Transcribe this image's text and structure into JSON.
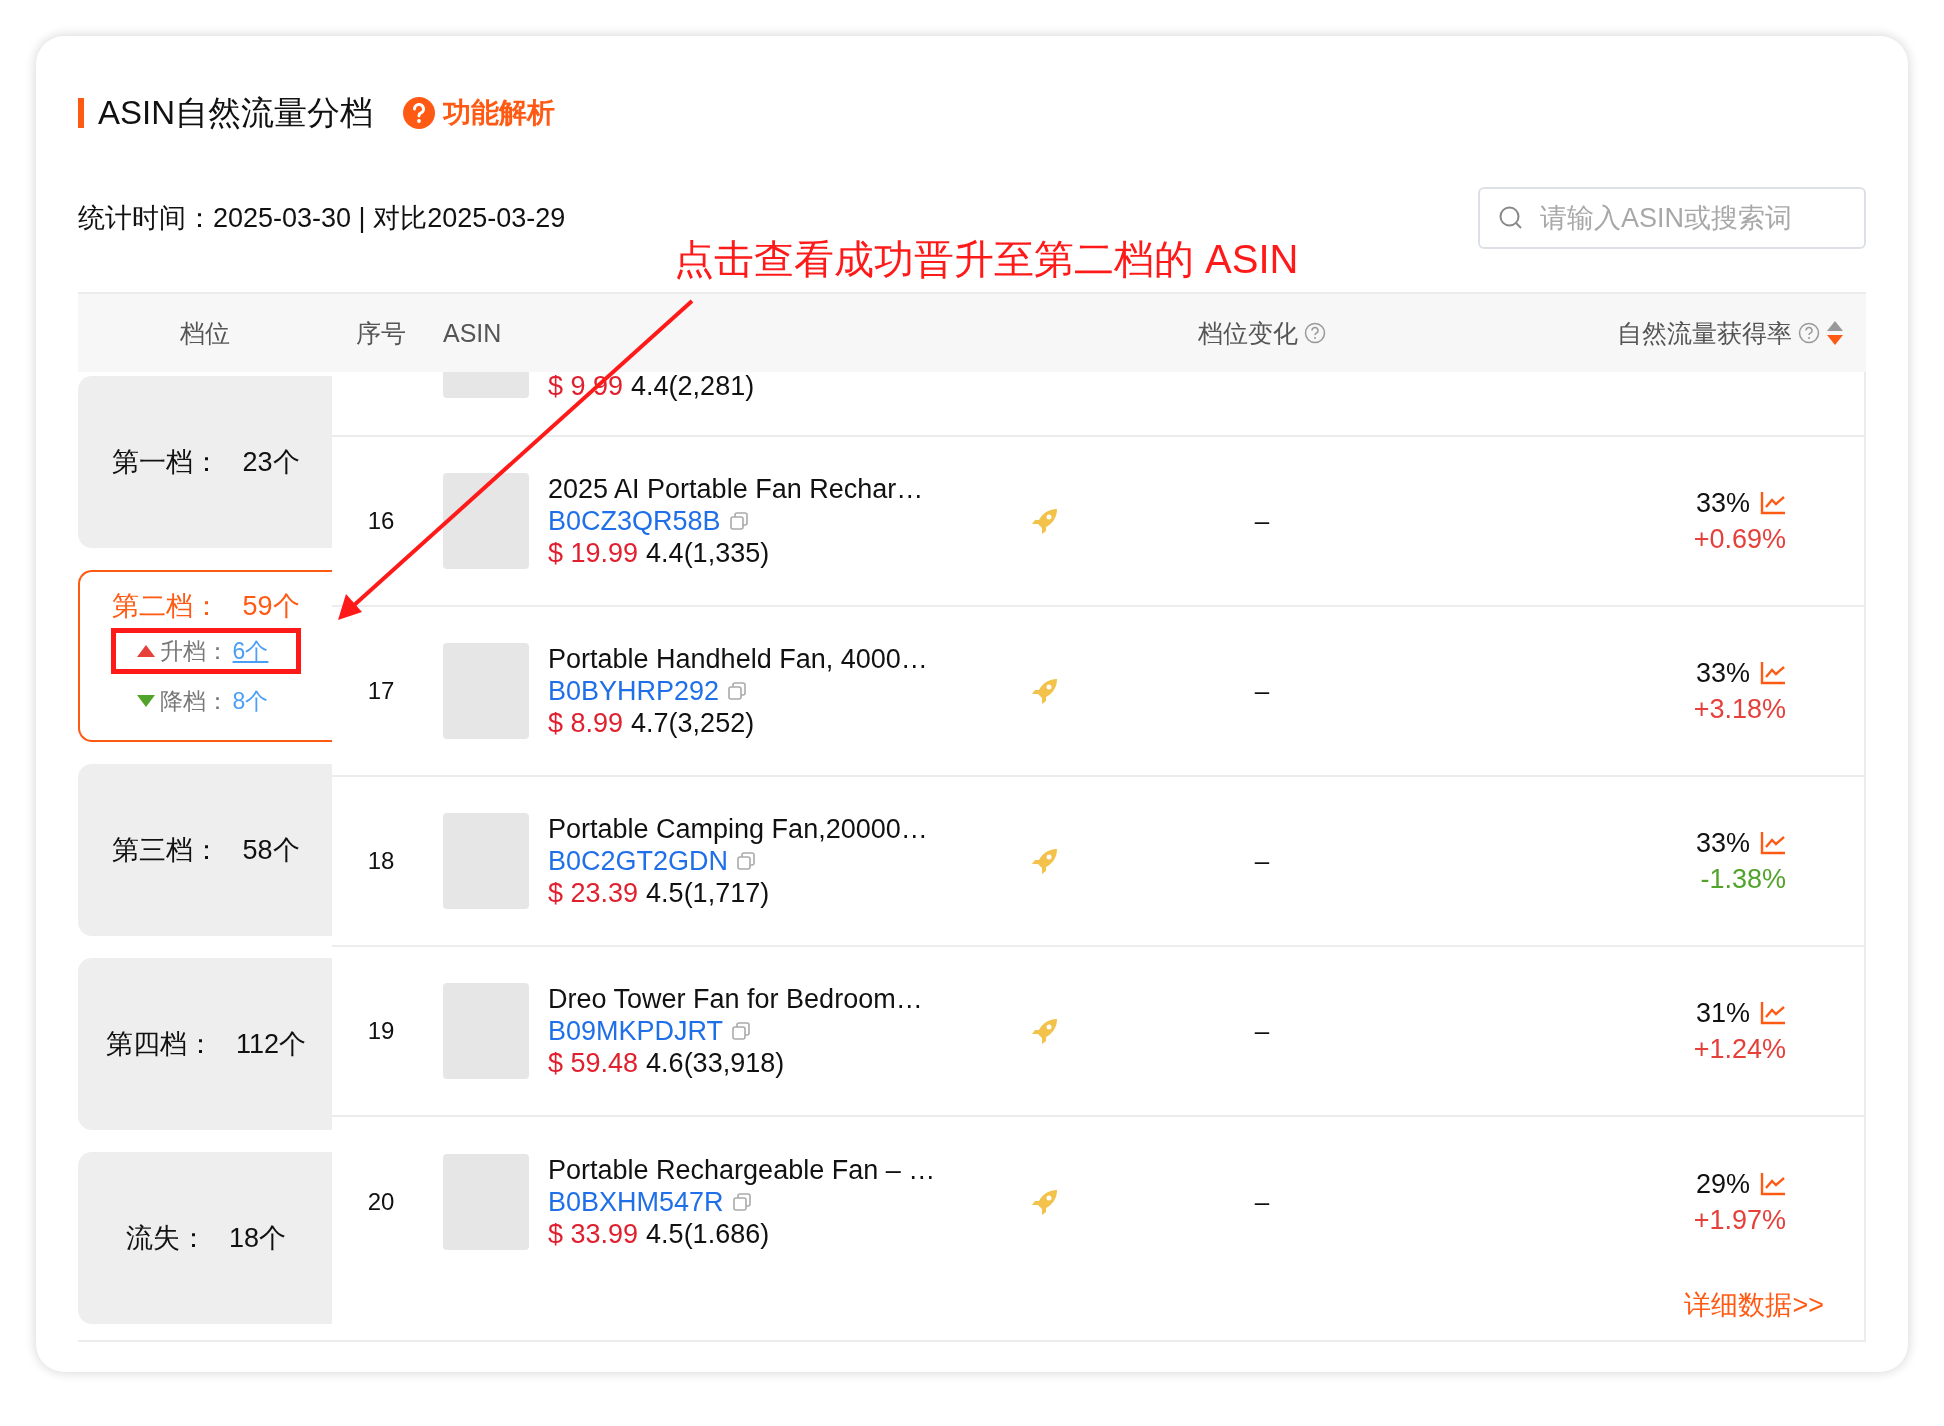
{
  "header": {
    "title": "ASIN自然流量分档",
    "help_link": "功能解析"
  },
  "stats": {
    "text": "统计时间：2025-03-30 | 对比2025-03-29"
  },
  "search": {
    "placeholder": "请输入ASIN或搜索词"
  },
  "annotation": {
    "text": "点击查看成功晋升至第二档的 ASIN"
  },
  "table": {
    "columns": [
      {
        "label": "档位"
      },
      {
        "label": "序号"
      },
      {
        "label": "ASIN"
      },
      {
        "label": "档位变化",
        "help": true
      },
      {
        "label": "自然流量获得率",
        "help": true,
        "sort_desc": true
      }
    ],
    "tiers": [
      {
        "label": "第一档：",
        "count": "23个",
        "selected": false
      },
      {
        "label": "第二档：",
        "count": "59个",
        "selected": true,
        "changes": [
          {
            "kind": "up",
            "label": "升档：",
            "count": "6个",
            "hovered": true,
            "annotated": true
          },
          {
            "kind": "down",
            "label": "降档：",
            "count": "8个",
            "hovered": false,
            "annotated": false
          }
        ]
      },
      {
        "label": "第三档：",
        "count": "58个",
        "selected": false
      },
      {
        "label": "第四档：",
        "count": "112个",
        "selected": false
      },
      {
        "label": "流失：",
        "count": "18个",
        "selected": false
      }
    ],
    "rows": [
      {
        "kind": "partial",
        "price": "$ 9.99",
        "rating": "4.4(2,281)"
      },
      {
        "kind": "full",
        "index": "16",
        "name": "2025 AI Portable Fan Rechar…",
        "asin": "B0CZ3QR58B",
        "price": "$ 19.99",
        "rating": "4.4(1,335)",
        "boosted": true,
        "tier_change": "–",
        "rate": "33%",
        "delta": "+0.69%",
        "rising": true
      },
      {
        "kind": "full",
        "index": "17",
        "name": "Portable Handheld Fan, 4000…",
        "asin": "B0BYHRP292",
        "price": "$ 8.99",
        "rating": "4.7(3,252)",
        "boosted": true,
        "tier_change": "–",
        "rate": "33%",
        "delta": "+3.18%",
        "rising": true
      },
      {
        "kind": "full",
        "index": "18",
        "name": "Portable Camping Fan,20000…",
        "asin": "B0C2GT2GDN",
        "price": "$ 23.39",
        "rating": "4.5(1,717)",
        "boosted": true,
        "tier_change": "–",
        "rate": "33%",
        "delta": "-1.38%",
        "rising": false
      },
      {
        "kind": "full",
        "index": "19",
        "name": "Dreo Tower Fan for Bedroom…",
        "asin": "B09MKPDJRT",
        "price": "$ 59.48",
        "rating": "4.6(33,918)",
        "boosted": true,
        "tier_change": "–",
        "rate": "31%",
        "delta": "+1.24%",
        "rising": true
      },
      {
        "kind": "full",
        "index": "20",
        "name": "Portable Rechargeable Fan – …",
        "asin": "B0BXHM547R",
        "price": "$ 33.99",
        "rating": "4.5(1.686)",
        "boosted": true,
        "tier_change": "–",
        "rate": "29%",
        "delta": "+1.97%",
        "rising": true
      }
    ],
    "footer_link": "详细数据>>"
  }
}
